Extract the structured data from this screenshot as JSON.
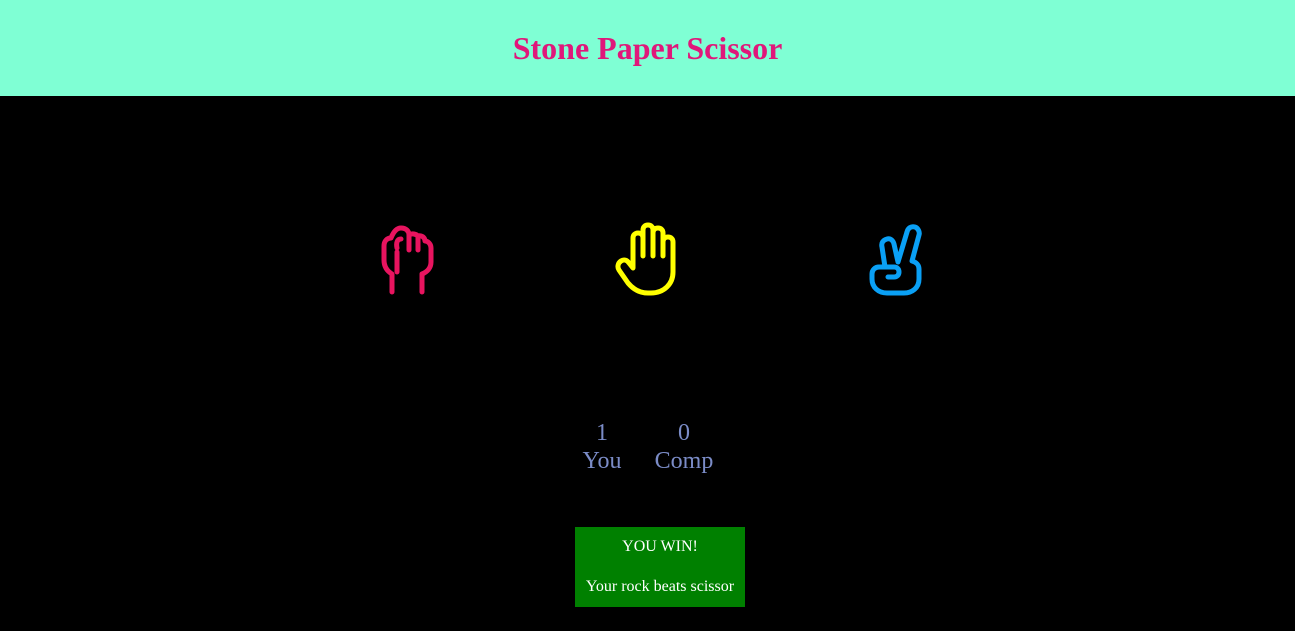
{
  "header": {
    "title": "Stone Paper Scissor"
  },
  "choices": [
    {
      "id": "rock",
      "icon": "fist-icon",
      "color": "#e8145f"
    },
    {
      "id": "paper",
      "icon": "open-hand-icon",
      "color": "#ffff00"
    },
    {
      "id": "scissor",
      "icon": "victory-hand-icon",
      "color": "#0aa0f5"
    }
  ],
  "score": {
    "user_score": "1",
    "user_label": "You",
    "comp_score": "0",
    "comp_label": "Comp"
  },
  "result": {
    "status": "YOU WIN!",
    "message": "Your rock beats scissor",
    "background": "#008000"
  },
  "colors": {
    "header_bg": "#7fffd4",
    "title": "#e0177a",
    "page_bg": "#000000",
    "score_text": "#7b8cc7"
  }
}
